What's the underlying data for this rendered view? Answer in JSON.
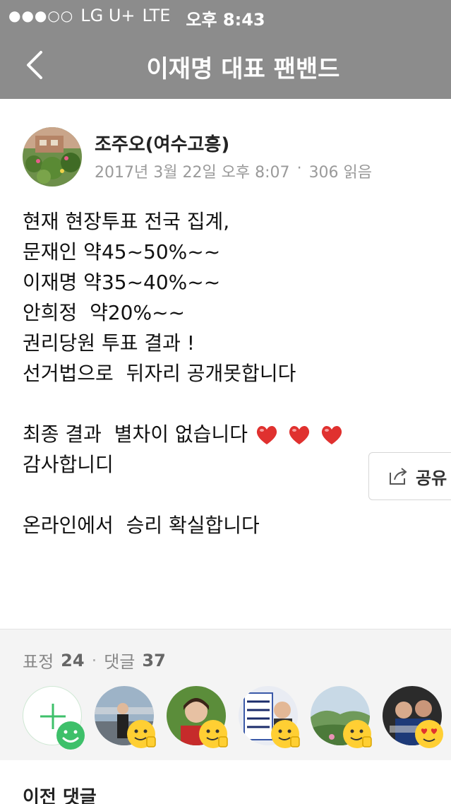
{
  "status_bar": {
    "carrier": "LG U+",
    "network": "LTE",
    "time": "오후 8:43"
  },
  "nav": {
    "title": "이재명 대표 팬밴드",
    "back_icon": "chevron-left-icon"
  },
  "post": {
    "author": "조주오(여수고흥)",
    "date": "2017년 3월 22일 오후 8:07",
    "read_count": "306 읽음",
    "lines": [
      "현재 현장투표 전국 집계,",
      "문재인 약45~50%~~",
      "이재명 약35~40%~~",
      "안희정  약20%~~",
      "권리당원 투표 결과 !",
      "선거법으로  뒤자리 공개못합니다",
      "",
      "최종 결과  별차이 없습니다",
      "감사합니디",
      "",
      "온라인에서  승리 확실합니다"
    ],
    "share_label": "공유"
  },
  "reactions": {
    "emotion_label": "표정",
    "emotion_count": "24",
    "comment_label": "댓글",
    "comment_count": "37"
  },
  "comments": {
    "previous_label": "이전 댓글"
  },
  "colors": {
    "header_bg": "#8c8c8c",
    "heart": "#e0312f",
    "add_green": "#3ec06a"
  }
}
